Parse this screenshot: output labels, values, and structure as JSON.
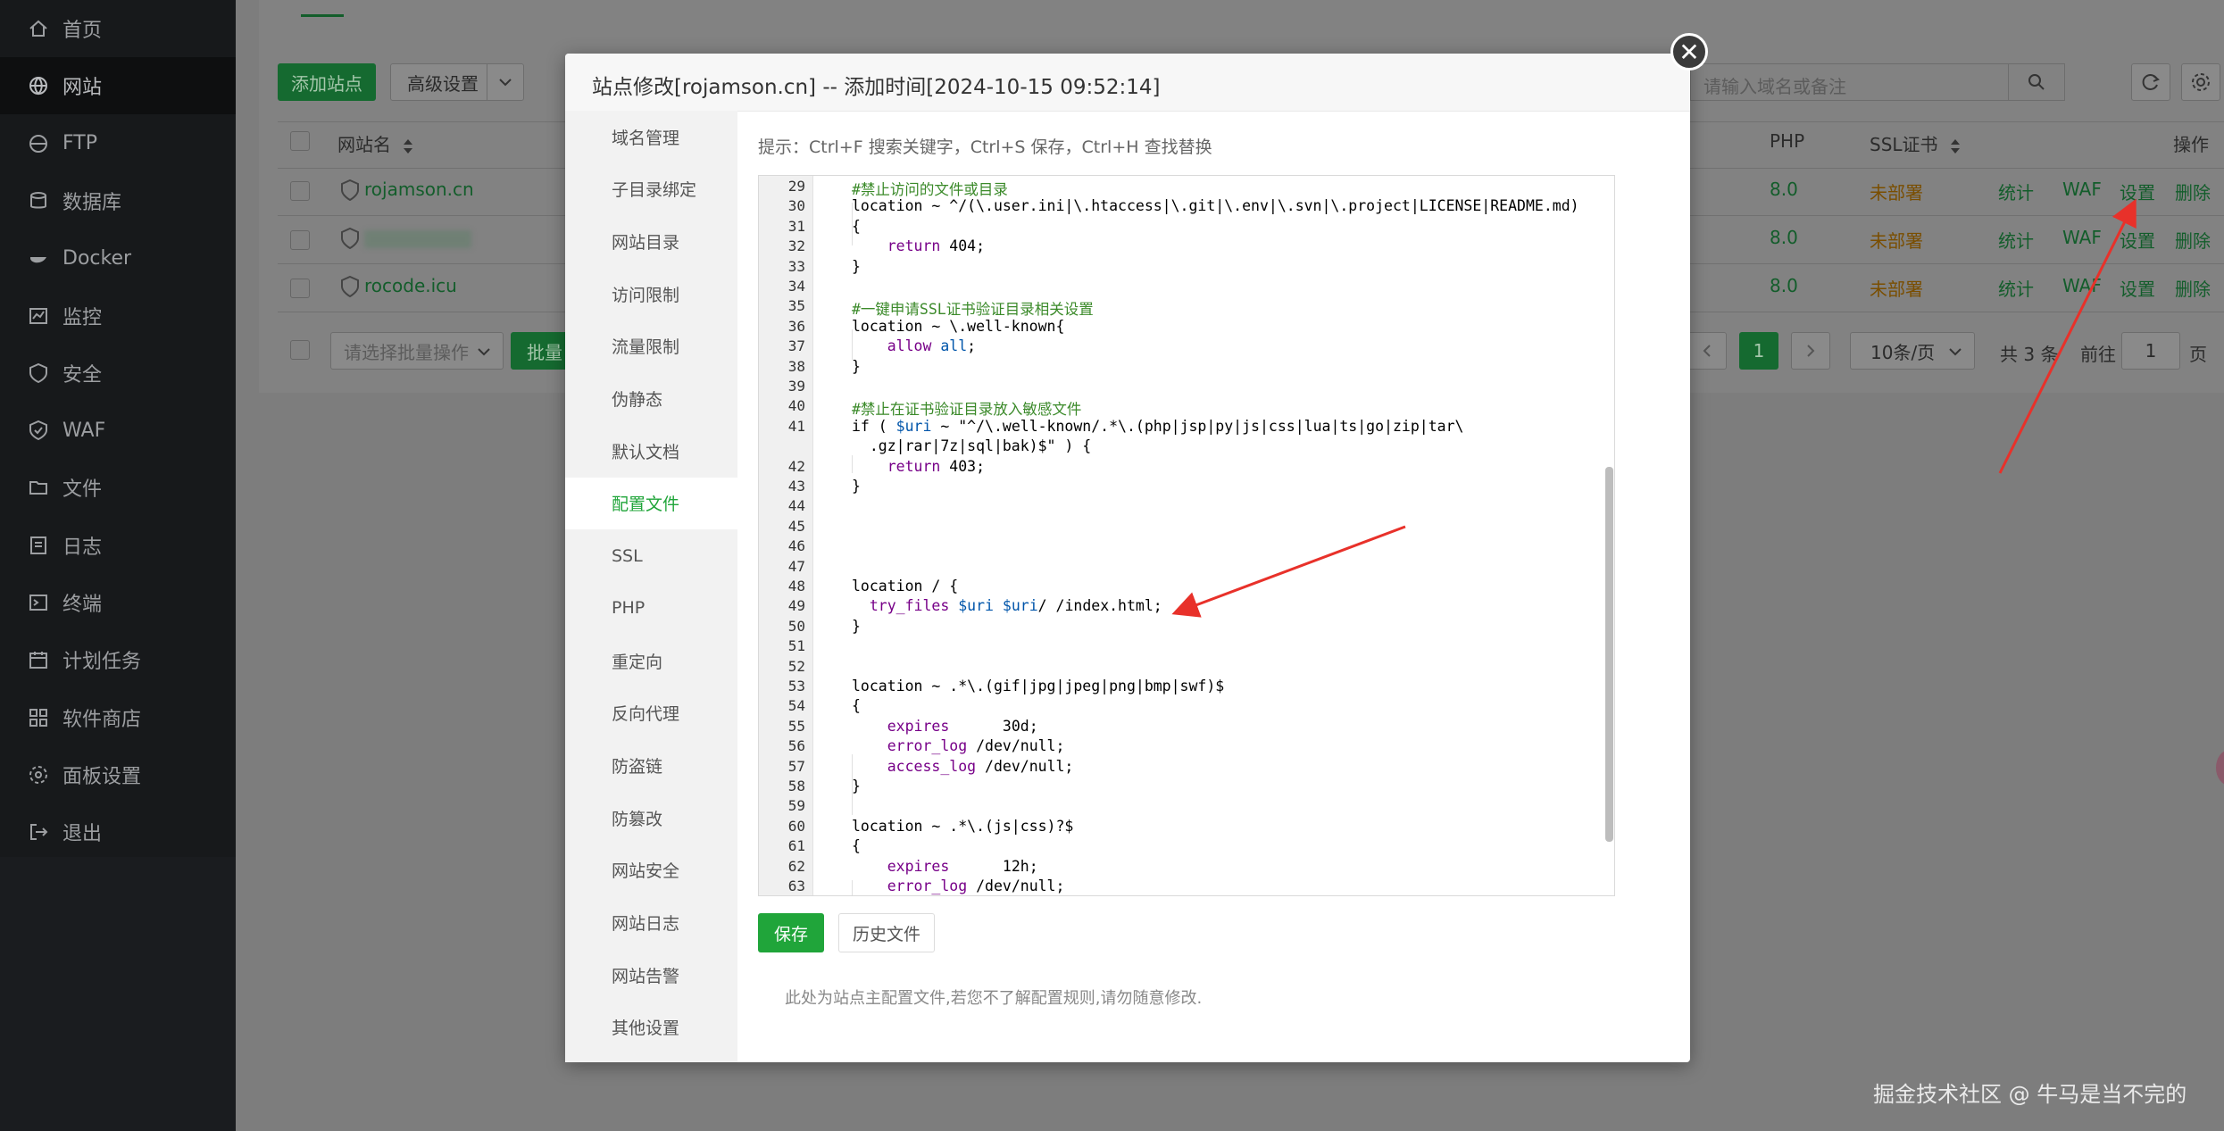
{
  "sidebar": {
    "items": [
      {
        "label": "首页",
        "icon": "home-icon"
      },
      {
        "label": "网站",
        "icon": "globe-icon",
        "active": true
      },
      {
        "label": "FTP",
        "icon": "ftp-icon"
      },
      {
        "label": "数据库",
        "icon": "database-icon"
      },
      {
        "label": "Docker",
        "icon": "docker-icon"
      },
      {
        "label": "监控",
        "icon": "monitor-icon"
      },
      {
        "label": "安全",
        "icon": "shield-icon"
      },
      {
        "label": "WAF",
        "icon": "waf-icon"
      },
      {
        "label": "文件",
        "icon": "folder-icon"
      },
      {
        "label": "日志",
        "icon": "log-icon"
      },
      {
        "label": "终端",
        "icon": "terminal-icon"
      },
      {
        "label": "计划任务",
        "icon": "calendar-icon"
      },
      {
        "label": "软件商店",
        "icon": "grid-icon"
      },
      {
        "label": "面板设置",
        "icon": "settings-icon"
      },
      {
        "label": "退出",
        "icon": "logout-icon"
      }
    ]
  },
  "toolbar": {
    "add_site": "添加站点",
    "advanced": "高级设置",
    "search_placeholder": "请输入域名或备注"
  },
  "table": {
    "headers": {
      "name": "网站名",
      "php": "PHP",
      "ssl": "SSL证书",
      "action": "操作"
    },
    "rows": [
      {
        "name": "rojamson.cn",
        "php": "8.0",
        "ssl": "未部署"
      },
      {
        "name": "",
        "php": "8.0",
        "ssl": "未部署"
      },
      {
        "name": "rocode.icu",
        "php": "8.0",
        "ssl": "未部署"
      }
    ],
    "actions": {
      "stats": "统计",
      "waf": "WAF",
      "settings": "设置",
      "delete": "删除"
    },
    "batch_placeholder": "请选择批量操作",
    "batch_btn": "批量"
  },
  "pagination": {
    "current": "1",
    "per_page": "10条/页",
    "total": "共 3 条",
    "goto": "前往",
    "goto_value": "1",
    "page": "页"
  },
  "modal": {
    "title": "站点修改[rojamson.cn] -- 添加时间[2024-10-15 09:52:14]",
    "nav": [
      "域名管理",
      "子目录绑定",
      "网站目录",
      "访问限制",
      "流量限制",
      "伪静态",
      "默认文档",
      "配置文件",
      "SSL",
      "PHP",
      "重定向",
      "反向代理",
      "防盗链",
      "防篡改",
      "网站安全",
      "网站日志",
      "网站告警",
      "其他设置"
    ],
    "active_nav": "配置文件",
    "hint": "提示：Ctrl+F 搜索关键字，Ctrl+S 保存，Ctrl+H 查找替换",
    "save": "保存",
    "history": "历史文件",
    "note": "此处为站点主配置文件,若您不了解配置规则,请勿随意修改."
  },
  "code_lines": [
    {
      "n": "29",
      "t": "#禁止访问的文件或目录"
    },
    {
      "n": "30",
      "t": "location ~ ^/(\\.user.ini|\\.htaccess|\\.git|\\.env|\\.svn|\\.project|LICENSE|README.md)"
    },
    {
      "n": "31",
      "t": "{"
    },
    {
      "n": "32",
      "t": "    return 404;"
    },
    {
      "n": "33",
      "t": "}"
    },
    {
      "n": "34",
      "t": ""
    },
    {
      "n": "35",
      "t": "#一键申请SSL证书验证目录相关设置"
    },
    {
      "n": "36",
      "t": "location ~ \\.well-known{"
    },
    {
      "n": "37",
      "t": "    allow all;"
    },
    {
      "n": "38",
      "t": "}"
    },
    {
      "n": "39",
      "t": ""
    },
    {
      "n": "40",
      "t": "#禁止在证书验证目录放入敏感文件"
    },
    {
      "n": "41",
      "t": "if ( $uri ~ \"^/\\.well-known/.*\\.(php|jsp|py|js|css|lua|ts|go|zip|tar\\"
    },
    {
      "n": "",
      "t": "  .gz|rar|7z|sql|bak)$\" ) {"
    },
    {
      "n": "42",
      "t": "    return 403;"
    },
    {
      "n": "43",
      "t": "}"
    },
    {
      "n": "44",
      "t": ""
    },
    {
      "n": "45",
      "t": ""
    },
    {
      "n": "46",
      "t": ""
    },
    {
      "n": "47",
      "t": ""
    },
    {
      "n": "48",
      "t": "location / {"
    },
    {
      "n": "49",
      "t": "  try_files $uri $uri/ /index.html;"
    },
    {
      "n": "50",
      "t": "}"
    },
    {
      "n": "51",
      "t": ""
    },
    {
      "n": "52",
      "t": ""
    },
    {
      "n": "53",
      "t": "location ~ .*\\.(gif|jpg|jpeg|png|bmp|swf)$"
    },
    {
      "n": "54",
      "t": "{"
    },
    {
      "n": "55",
      "t": "    expires      30d;"
    },
    {
      "n": "56",
      "t": "    error_log /dev/null;"
    },
    {
      "n": "57",
      "t": "    access_log /dev/null;"
    },
    {
      "n": "58",
      "t": "}"
    },
    {
      "n": "59",
      "t": ""
    },
    {
      "n": "60",
      "t": "location ~ .*\\.(js|css)?$"
    },
    {
      "n": "61",
      "t": "{"
    },
    {
      "n": "62",
      "t": "    expires      12h;"
    },
    {
      "n": "63",
      "t": "    error_log /dev/null;"
    }
  ],
  "watermark": "掘金技术社区 @ 牛马是当不完的",
  "colors": {
    "accent": "#20a53a",
    "annotation_arrow": "#e8312a"
  }
}
